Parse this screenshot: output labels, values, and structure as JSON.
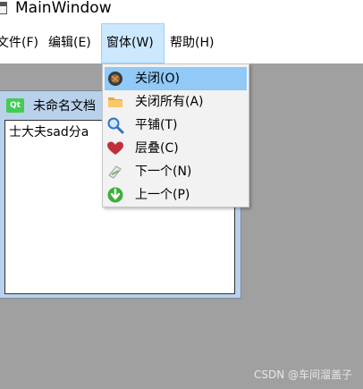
{
  "window": {
    "title": "MainWindow"
  },
  "menubar": {
    "items": [
      {
        "label": "文件(F)"
      },
      {
        "label": "编辑(E)"
      },
      {
        "label": "窗体(W)"
      },
      {
        "label": "帮助(H)"
      }
    ]
  },
  "subwindow": {
    "title": "未命名文档",
    "icon_text": "Qt",
    "content": "士大夫sad分a"
  },
  "window_menu": {
    "items": [
      {
        "label": "关闭(O)",
        "icon": "close-sphere-icon"
      },
      {
        "label": "关闭所有(A)",
        "icon": "folder-icon"
      },
      {
        "label": "平铺(T)",
        "icon": "magnifier-icon"
      },
      {
        "label": "层叠(C)",
        "icon": "heart-icon"
      },
      {
        "label": "下一个(N)",
        "icon": "paper-arrow-icon"
      },
      {
        "label": "上一个(P)",
        "icon": "green-arrow-down-icon"
      }
    ]
  },
  "watermark": "CSDN @车间溜盖子",
  "colors": {
    "menu_active_bg": "#cce8ff",
    "menu_hover_bg": "#91c9f7",
    "mdi_bg": "#a0a0a0",
    "subwindow_frame": "#b9d1ea"
  }
}
